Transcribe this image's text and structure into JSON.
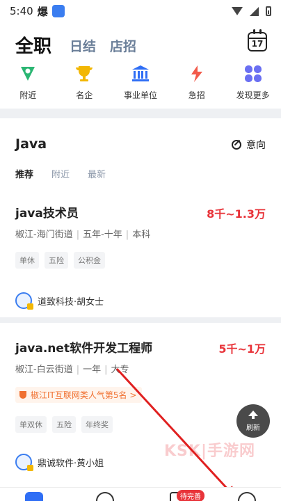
{
  "status": {
    "time": "5:40",
    "boom": "爆"
  },
  "header": {
    "main_tab": "全职",
    "tabs": [
      "日结",
      "店招"
    ],
    "calendar_day": "17"
  },
  "quick": [
    {
      "label": "附近",
      "icon": "location-icon",
      "color": "#2bb673"
    },
    {
      "label": "名企",
      "icon": "trophy-icon",
      "color": "#f2b705"
    },
    {
      "label": "事业单位",
      "icon": "building-icon",
      "color": "#2f6ef5"
    },
    {
      "label": "急招",
      "icon": "lightning-icon",
      "color": "#f25a4a"
    },
    {
      "label": "发现更多",
      "icon": "grid-icon",
      "color": "#6a6ff2"
    }
  ],
  "section": {
    "title": "Java",
    "intent": "意向",
    "subtabs": [
      "推荐",
      "附近",
      "最新"
    ]
  },
  "jobs": [
    {
      "title": "java技术员",
      "salary": "8千~1.3万",
      "meta": [
        "椒江-海门街道",
        "五年-十年",
        "本科"
      ],
      "tags": [
        "单休",
        "五险",
        "公积金"
      ],
      "company": "道致科技·胡女士"
    },
    {
      "title": "java.net软件开发工程师",
      "salary": "5千~1万",
      "meta": [
        "椒江-白云街道",
        "一年",
        "大专"
      ],
      "badge": "椒江IT互联网类人气第5名 >",
      "tags": [
        "单双休",
        "五险",
        "年终奖"
      ],
      "company": "鼎诚软件·黄小姐"
    }
  ],
  "refresh_label": "刷新",
  "watermark": "KSK|手游网",
  "nav": {
    "pending": "待完善"
  }
}
